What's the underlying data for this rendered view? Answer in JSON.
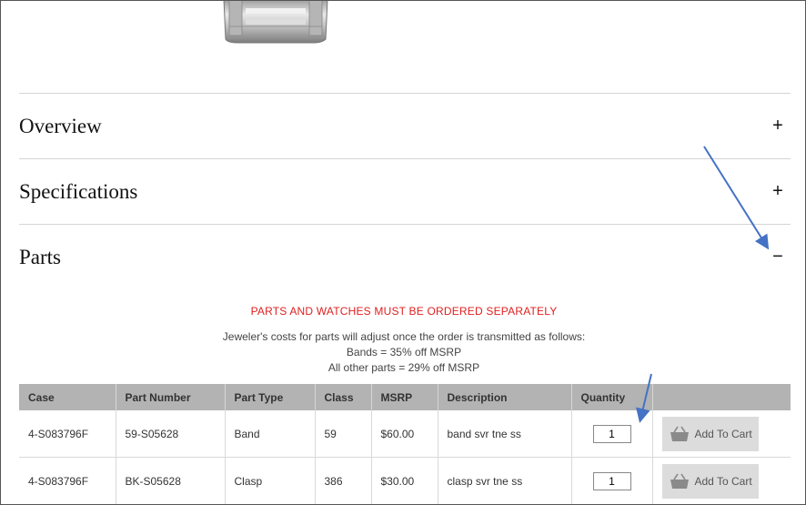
{
  "accordion": {
    "sections": [
      {
        "title": "Overview",
        "toggle": "+"
      },
      {
        "title": "Specifications",
        "toggle": "+"
      },
      {
        "title": "Parts",
        "toggle": "−"
      }
    ]
  },
  "parts": {
    "notice": "PARTS AND WATCHES MUST BE ORDERED SEPARATELY",
    "info_lines": [
      "Jeweler's costs for parts will adjust once the order is transmitted as follows:",
      "Bands = 35% off MSRP",
      "All other parts = 29% off MSRP"
    ],
    "columns": [
      "Case",
      "Part Number",
      "Part Type",
      "Class",
      "MSRP",
      "Description",
      "Quantity",
      ""
    ],
    "rows": [
      {
        "case": "4-S083796F",
        "part_number": "59-S05628",
        "part_type": "Band",
        "class": "59",
        "msrp": "$60.00",
        "description": "band svr tne ss",
        "quantity": "1",
        "cart_label": "Add To Cart"
      },
      {
        "case": "4-S083796F",
        "part_number": "BK-S05628",
        "part_type": "Clasp",
        "class": "386",
        "msrp": "$30.00",
        "description": "clasp svr tne ss",
        "quantity": "1",
        "cart_label": "Add To Cart"
      }
    ]
  },
  "colors": {
    "notice": "#e02020",
    "header_bg": "#b3b3b3",
    "arrow": "#4472c4",
    "button_bg": "#dcdcdc"
  },
  "icons": [
    "watch-band-image",
    "basket-icon",
    "annotation-arrow"
  ]
}
